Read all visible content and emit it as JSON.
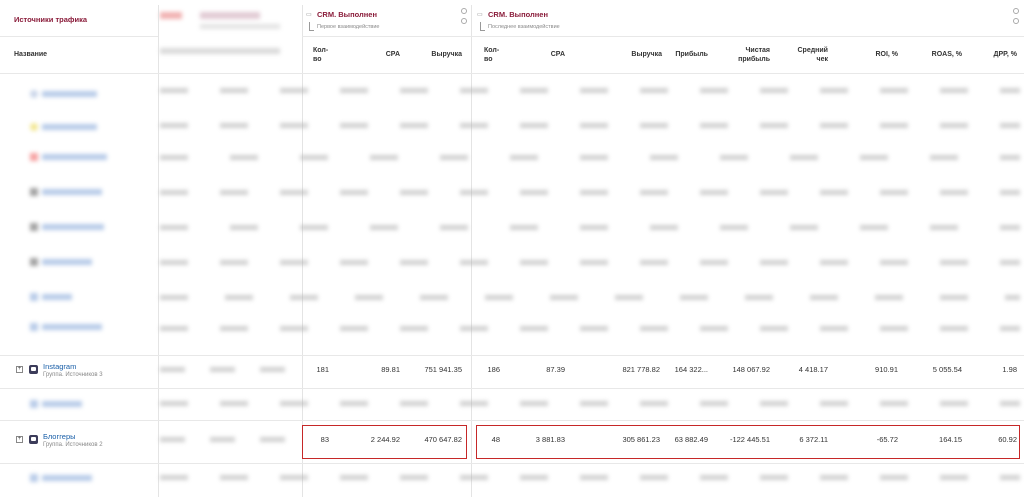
{
  "left_panel": {
    "title": "Источники трафика",
    "name_header": "Название"
  },
  "groups": [
    {
      "title": "CRM. Выполнен",
      "subtitle": "Первое взаимодействие",
      "columns": [
        "Кол-во",
        "CPA",
        "Выручка"
      ]
    },
    {
      "title": "CRM. Выполнен",
      "subtitle": "Последнее взаимодействие",
      "columns": [
        "Кол-во",
        "CPA",
        "Выручка",
        "Прибыль",
        "Чистая прибыль",
        "Средний чек",
        "ROI, %",
        "ROAS, %",
        "ДРР, %"
      ]
    }
  ],
  "rows": {
    "instagram": {
      "name": "Instagram",
      "subtitle": "Группа. Источников 3",
      "first": [
        "181",
        "89.81",
        "751 941.35"
      ],
      "last": [
        "186",
        "87.39",
        "821 778.82",
        "164 322...",
        "148 067.92",
        "4 418.17",
        "910.91",
        "5 055.54",
        "1.98"
      ]
    },
    "bloggers": {
      "name": "Блоггеры",
      "subtitle": "Группа. Источников 2",
      "first": [
        "83",
        "2 244.92",
        "470 647.82"
      ],
      "last": [
        "48",
        "3 881.83",
        "305 861.23",
        "63 882.49",
        "-122 445.51",
        "6 372.11",
        "-65.72",
        "164.15",
        "60.92"
      ]
    }
  },
  "colors": {
    "accent": "#8a1c3a",
    "highlight_border": "#c62828"
  }
}
